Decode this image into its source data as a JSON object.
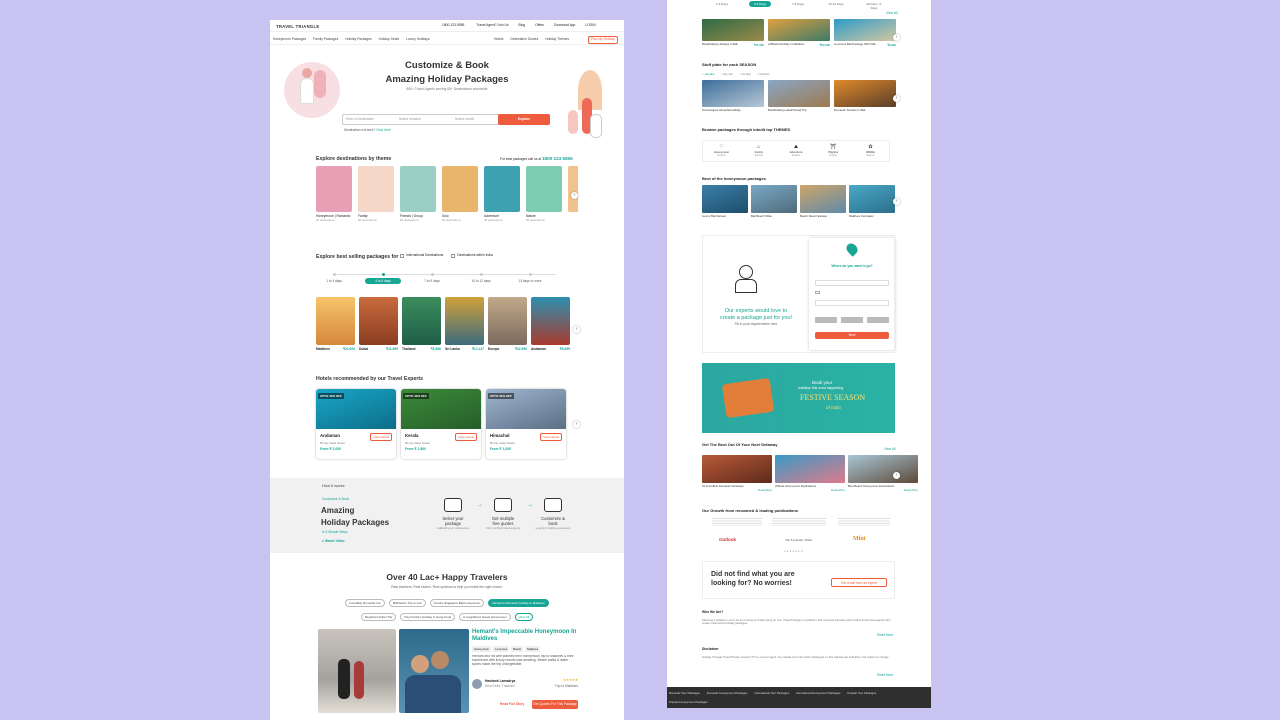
{
  "left": {
    "logo": "TRAVEL TRIANGLE",
    "phone": "1800-123-5555",
    "topnav": [
      "Travel Agent? Join Us",
      "Blog",
      "Offers",
      "Download App",
      "LOGIN"
    ],
    "menu": [
      "Honeymoon Packages",
      "Family Packages",
      "Holiday Packages",
      "Holiday Deals",
      "Luxury Holidays"
    ],
    "menu_right": [
      "Hotels",
      "Destination Guides",
      "Holiday Themes"
    ],
    "plan_btn": "Plan My Holiday",
    "hero_title1": "Customize & Book",
    "hero_title2": "Amazing Holiday Packages",
    "hero_sub": "650+ Travel Agents serving 65+ Destinations worldwide",
    "dest_placeholder": "Enter a Destination",
    "duration_placeholder": "Select duration",
    "month_placeholder": "Select month",
    "explore_btn": "Explore",
    "not_sure": "Destination not sure?",
    "not_sure_link": "Click here",
    "theme_title": "Explore destinations by theme",
    "theme_call": "For best packages call us at",
    "theme_phone": "1800 123 5555",
    "themes": [
      {
        "name": "Honeymoon | Romantic",
        "sub": "84 destinations",
        "color": "#e9a0b6"
      },
      {
        "name": "Family",
        "sub": "86 destinations",
        "color": "#f4d7c6"
      },
      {
        "name": "Friends | Group",
        "sub": "86 destinations",
        "color": "#9ad0c4"
      },
      {
        "name": "Solo",
        "sub": "86 destinations",
        "color": "#e8b56d"
      },
      {
        "name": "Adventure",
        "sub": "46 destinations",
        "color": "#3ea1b2"
      },
      {
        "name": "Nature",
        "sub": "86 destinations",
        "color": "#7ccdb2"
      },
      {
        "name": "",
        "sub": "",
        "color": "#f1c28c"
      }
    ],
    "bestsell_title": "Explore best selling packages for",
    "intl": "International Destinations",
    "within": "Destinations within India",
    "durations": [
      "1 to 3 days",
      "4 to 6 days",
      "7 to 9 days",
      "10 to 12 days",
      "13 days or more"
    ],
    "packages": [
      {
        "name": "Maldives",
        "price": "₹22,000",
        "c1": "#f6c46a",
        "c2": "#d5873c"
      },
      {
        "name": "Dubai",
        "price": "₹11,999",
        "c1": "#c86b3d",
        "c2": "#8b3d22"
      },
      {
        "name": "Thailand",
        "price": "₹6,656",
        "c1": "#3b8e5e",
        "c2": "#1f5e48"
      },
      {
        "name": "Sri Lanka",
        "price": "₹12,137",
        "c1": "#d0a23c",
        "c2": "#3d6b7c"
      },
      {
        "name": "Europe",
        "price": "₹32,995",
        "c1": "#c2a98a",
        "c2": "#7b6a5e"
      },
      {
        "name": "Andaman",
        "price": "₹8,999",
        "c1": "#2d8fb0",
        "c2": "#a93a2d"
      }
    ],
    "hotels_title": "Hotels recommended by our Travel Experts",
    "hotels": [
      {
        "badge": "UPTO 40% OFF",
        "name": "Andaman",
        "count": "50 top rated hotels",
        "price": "From ₹ 2,000",
        "c1": "#1aa6c7",
        "c2": "#0c6e8a",
        "btn": "View Hotels"
      },
      {
        "badge": "UPTO 40% OFF",
        "name": "Kerala",
        "count": "50 top rated hotels",
        "price": "From ₹ 1,800",
        "c1": "#3c8a3a",
        "c2": "#265e2a",
        "btn": "View Hotels"
      },
      {
        "badge": "UPTO 30% OFF",
        "name": "Himachal",
        "count": "50 top rated hotels",
        "price": "From ₹ 1,000",
        "c1": "#9fb6cf",
        "c2": "#5b6e86",
        "btn": "View Hotels"
      }
    ],
    "how_label": "How it works",
    "how_sub": "Customize & Book",
    "how_title1": "Amazing",
    "how_title2": "Holiday Packages",
    "how_steps_note": "in 3 Simple Steps",
    "how_watch": "Watch Video",
    "steps": [
      {
        "t1": "Select your",
        "t2": "package",
        "d": "Add/edit your preferences"
      },
      {
        "t1": "Get multiple",
        "t2": "free quotes",
        "d": "From verified travel experts"
      },
      {
        "t1": "Customize &",
        "t2": "book",
        "d": "a perfect holiday experience"
      }
    ],
    "happy_title": "Over 40 Lac+ Happy Travelers",
    "happy_sub": "Real travelers. Real stories. Real opinions to help you make the right choice.",
    "chips1": [
      "Incredibly Romantic trip",
      "Mithilesh's Trip to Leh",
      "Kunal's Singapore Bali honeymoon",
      "Hemant's Romantic holiday to Maldives"
    ],
    "chips2": [
      "Meghna's Dubai Trip",
      "Pay Family's Holiday in Hong Kong",
      "A magnificent Greek honeymoon",
      "View All"
    ],
    "story_title": "Hemant's Impeccable Honeymoon In Maldives",
    "story_tags": [
      "Honeymoon",
      "Luxurious",
      "Beach",
      "Maldives"
    ],
    "story_text": "Hemant and his wife planned their honeymoon trip to Maldives & their experience with luxury resorts was amazing. Beach walks & water sports made the trip unforgettable.",
    "traveler_name": "Hashank Lamadrya",
    "traveler_meta": "New Delhi, Traveled",
    "trip_to": "Trip to Maldives",
    "rating": "★★★★★",
    "read_btn": "Read Full Story",
    "quote_btn": "Get Quotes For This Package"
  },
  "right": {
    "tabs": [
      "1-3 Days",
      "4-6 Days",
      "7-9 Days",
      "10-12 Days",
      "All Days >1 Days"
    ],
    "active_tab": "4-6 Days",
    "top_cards": [
      {
        "name": "Breathtaking Holidays In Bali",
        "price": "₹11,000",
        "c1": "#2d6b45",
        "c2": "#9c8a4a"
      },
      {
        "name": "A Blissful Holiday In Maldives",
        "price": "₹52,000",
        "c1": "#e0a040",
        "c2": "#3d7a68"
      },
      {
        "name": "Luxurious Bali Package With Villa",
        "price": "₹8,990",
        "c1": "#2b9bc7",
        "c2": "#d5c7a3"
      }
    ],
    "view_all": "View All",
    "stuff_title": "Stuff plate for each SEASON",
    "seasons": [
      "Jan-Mar",
      "Apr-Jun",
      "Jul-Sep",
      "Oct-Dec"
    ],
    "season_cards": [
      {
        "name": "Snowcapped Himachal Holiday",
        "c1": "#3c6e9a",
        "c2": "#b9c7d5"
      },
      {
        "name": "Breathtaking Ladakh Road Trip",
        "c1": "#8aa6c7",
        "c2": "#9d7a4e"
      },
      {
        "name": "Romantic Sunsets In Bali",
        "c1": "#e08a2a",
        "c2": "#5a3e2a"
      }
    ],
    "browse_title": "Browse packages through inbuilt top THEMES",
    "browse_items": [
      {
        "name": "Honeymoon",
        "sub": "Explore",
        "icon": "♡"
      },
      {
        "name": "Family",
        "sub": "Explore",
        "icon": "⌂"
      },
      {
        "name": "Adventure",
        "sub": "Explore",
        "icon": "⛰"
      },
      {
        "name": "Pilgrims",
        "sub": "Explore",
        "icon": "⛩"
      },
      {
        "name": "Wildlife",
        "sub": "Explore",
        "icon": "✿"
      }
    ],
    "honeymoon_title": "Best of the honeymoon packages",
    "honey_cards": [
      {
        "name": "Luxury Bali Retreat",
        "c1": "#3b7fa8",
        "c2": "#1d4e6b"
      },
      {
        "name": "Bali Beach Villas",
        "c1": "#7aa9c7",
        "c2": "#4e6b7a"
      },
      {
        "name": "Beach Resort Escape",
        "c1": "#cfa56a",
        "c2": "#5e8aa8"
      },
      {
        "name": "Maldives Overwater",
        "c1": "#4aa9c7",
        "c2": "#2b6e8a"
      }
    ],
    "form_title": "Where do you want to go?",
    "form_promo1": "Our experts would love to",
    "form_promo2": "create a package just for you!",
    "form_promo3": "Fill in your requirements here",
    "form_submit": "Next",
    "festive1": "Book your",
    "festive2": "holidays this most happening",
    "festive3": "FESTIVE SEASON",
    "festive4": "of India",
    "getaway_title": "Get The Best Out Of Your Next Getaway",
    "getaway": [
      {
        "name": "10 Incredible Romantic Getaways",
        "c1": "#b85a3a",
        "c2": "#5e2a1a"
      },
      {
        "name": "Offbeat Honeymoon Destinations",
        "c1": "#3a9ac7",
        "c2": "#e07a8a"
      },
      {
        "name": "Best Beach Honeymoon Destinations",
        "c1": "#a8c7d5",
        "c2": "#5e4a3a"
      }
    ],
    "read_more": "Read More",
    "growth_title": "Our Growth from renowned & leading publications",
    "press": [
      "Outlook",
      "The Economic Times",
      "Mint"
    ],
    "nw_title1": "Did not find what you are",
    "nw_title2": "looking for? No worries!",
    "nw_btn": "Get a call from an expert",
    "who_title": "Who We Are?",
    "who_text": "Planning a holiday is every bit as exciting as finally being on one. TravelTriangle is a platform that connects travelers with verified local travel agents who create customized holiday packages.",
    "disc_title": "Disclaimer",
    "disc_text": "Holiday Triangle Travel Private Limited (TT) is a travel agent. Any details and information displayed on this website are indicative and subject to change.",
    "readmore2": "Read More",
    "footer_links": [
      "Domestic Tour Packages",
      "Domestic Honeymoon Packages",
      "International Tour Packages",
      "International Honeymoon Packages",
      "Popular Tour Packages"
    ],
    "footer_last": "Popular Honeymoon Packages"
  }
}
